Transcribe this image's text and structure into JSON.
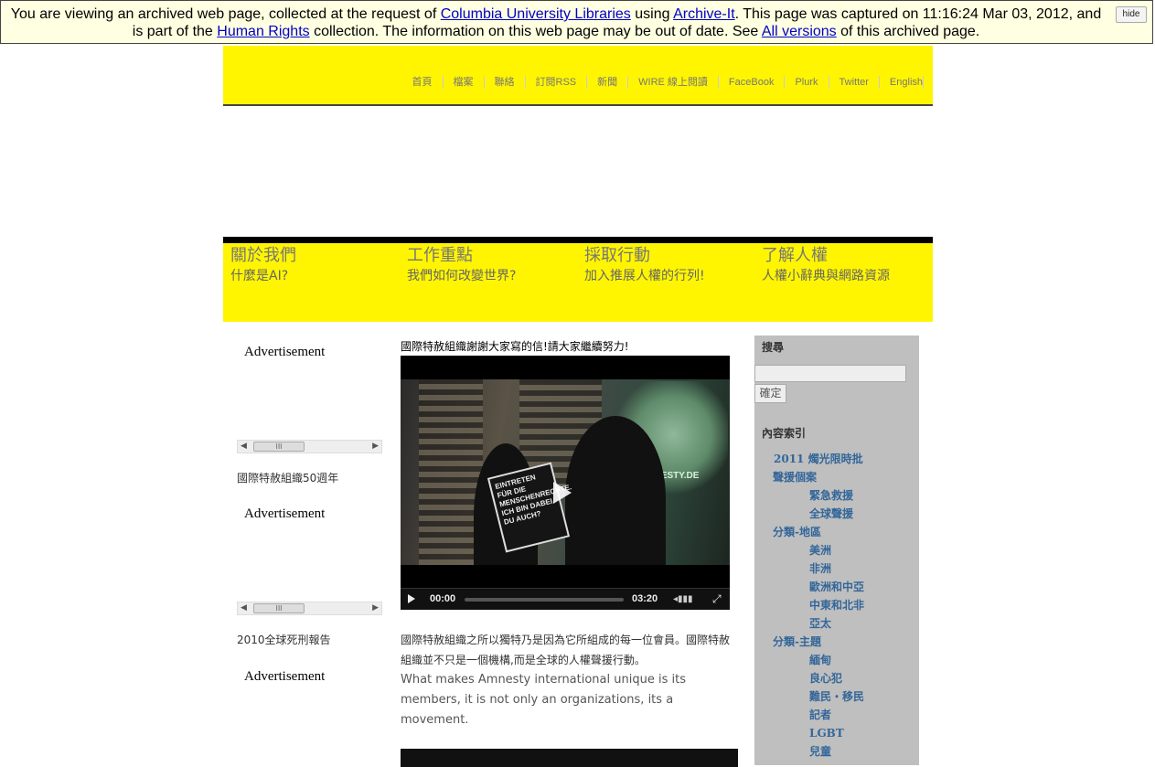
{
  "archive_banner": {
    "text_1": "You are viewing an archived web page, collected at the request of ",
    "link_1": "Columbia University Libraries",
    "text_2": " using ",
    "link_2": "Archive-It",
    "text_3": ". This page was captured on 11:16:24 Mar 03, 2012, and is part of the ",
    "link_3": "Human Rights",
    "text_4": " collection. The information on this web page may be out of date. See ",
    "link_4": "All versions",
    "text_5": " of this archived page.",
    "hide_label": "hide"
  },
  "top_nav": [
    "首頁",
    "檔案",
    "聯絡",
    "訂閱RSS",
    "新聞",
    "WIRE 線上閱讀",
    "FaceBook",
    "Plurk",
    "Twitter",
    "English"
  ],
  "sections": [
    {
      "title": "關於我們",
      "subtitle": "什麼是AI?"
    },
    {
      "title": "工作重點",
      "subtitle": "我們如何改變世界?"
    },
    {
      "title": "採取行動",
      "subtitle": "加入推展人權的行列!"
    },
    {
      "title": "了解人權",
      "subtitle": "人權小辭典與網路資源"
    }
  ],
  "left_column": {
    "ad_label": "Advertisement",
    "scroll_thumb": "III",
    "link_1": "國際特赦組織50週年",
    "link_2": "2010全球死刑報告"
  },
  "video": {
    "title": "國際特赦組織謝謝大家寫的信!請大家繼續努力!",
    "sign_text": "EINTRETEN FÜR DIE MENSCHENRECHTE. ICH BIN DABEI. DU AUCH?",
    "projection_text": "AMNESTY.DE",
    "current_time": "00:00",
    "duration": "03:20",
    "progress": 0
  },
  "description": {
    "zh": "國際特赦組織之所以獨特乃是因為它所組成的每一位會員。國際特赦組織並不只是一個機構,而是全球的人權聲援行動。",
    "en": "What makes Amnesty international unique is its members, it is not only an organizations, its a movement."
  },
  "sidebar": {
    "search_label": "搜尋",
    "search_placeholder": "",
    "search_button": "確定",
    "index_label": "內容索引",
    "items": [
      {
        "label": "2011 燭光限時批",
        "level": 0
      },
      {
        "label": "聲援個案",
        "level": 0
      },
      {
        "label": "緊急救援",
        "level": 1
      },
      {
        "label": "全球聲援",
        "level": 1
      },
      {
        "label": "分類-地區",
        "level": 0
      },
      {
        "label": "美洲",
        "level": 1
      },
      {
        "label": "非洲",
        "level": 1
      },
      {
        "label": "歐洲和中亞",
        "level": 1
      },
      {
        "label": "中東和北非",
        "level": 1
      },
      {
        "label": "亞太",
        "level": 1
      },
      {
        "label": "分類-主題",
        "level": 0
      },
      {
        "label": "緬甸",
        "level": 1
      },
      {
        "label": "良心犯",
        "level": 1
      },
      {
        "label": "難民・移民",
        "level": 1
      },
      {
        "label": "記者",
        "level": 1
      },
      {
        "label": "LGBT",
        "level": 1
      },
      {
        "label": "兒童",
        "level": 1
      }
    ]
  }
}
